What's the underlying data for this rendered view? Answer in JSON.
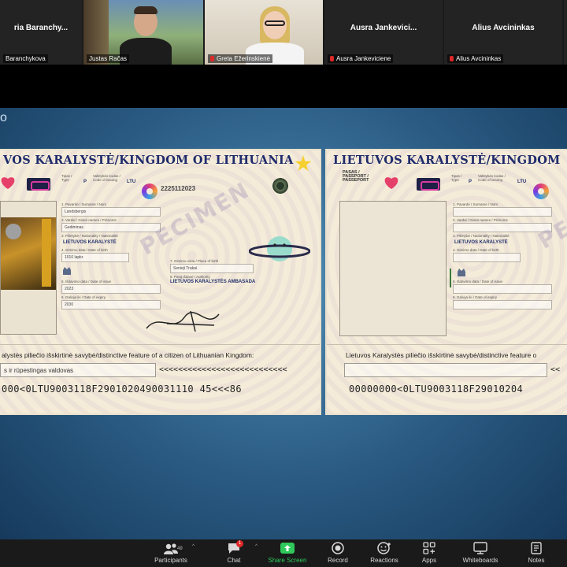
{
  "gallery": {
    "tiles": [
      {
        "big_name": "ria  Baranchy...",
        "tag": "Baranchykova"
      },
      {
        "big_name": "",
        "tag": "Justas Račas"
      },
      {
        "big_name": "",
        "tag": "Greta Ežerinskienė"
      },
      {
        "big_name": "Ausra  Jankevici...",
        "tag": "Ausra Jankeviciene"
      },
      {
        "big_name": "Alius Avcininkas",
        "tag": "Alius Avcininkas"
      }
    ]
  },
  "share": {
    "slide_label": "o",
    "card_left": {
      "title": "VOS KARALYSTĖ/KINGDOM OF LITHUANIA",
      "country_code": "LTU",
      "type_code": "P",
      "passport_no": "2225112023",
      "nationality": "LIETUVOS KARALYSTĖ",
      "authority": "LIETUVOS KARALYSTĖS AMBASADA",
      "specimen": "PECIMEN",
      "mrz_heading": "alystės piliečio išskirtinė savybė/distinctive feature of a citizen of Lithuanian Kingdom:",
      "mrz_feature": "s ir rūpestingas valdovas",
      "mrz_chevrons": "<<<<<<<<<<<<<<<<<<<<<<<<<<<",
      "mrz_line": "000<0LTU9003118F2901020490031110 45<<<86"
    },
    "card_right": {
      "title": "LIETUVOS KARALYSTĖ/KINGDOM",
      "header_left": "PASAS / PASSPORT / PASSEPORT",
      "country_code": "LTU",
      "type_code": "P",
      "nationality": "LIETUVOS KARALYSTĖ",
      "specimen": "PE",
      "mrz_heading": "Lietuvos Karalystės piliečio išskirtinė savybė/distinctive feature o",
      "mrz_chevrons": "<<",
      "mrz_line": "00000000<0LTU9003118F29010204"
    }
  },
  "toolbar": {
    "participants_label": "Participants",
    "participants_count": "49",
    "chat_label": "Chat",
    "chat_badge": "1",
    "share_label": "Share Screen",
    "record_label": "Record",
    "reactions_label": "Reactions",
    "apps_label": "Apps",
    "whiteboards_label": "Whiteboards",
    "notes_label": "Notes"
  },
  "colors": {
    "accent_green": "#2fc85a",
    "mute_red": "#e02828",
    "card_title": "#1f2b6b"
  }
}
